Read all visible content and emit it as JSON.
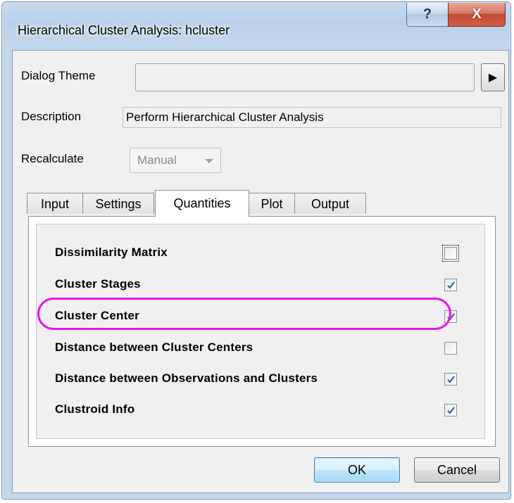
{
  "window": {
    "title": "Hierarchical Cluster Analysis: hcluster",
    "help_glyph": "?",
    "close_glyph": "X"
  },
  "theme": {
    "label": "Dialog Theme",
    "value": "",
    "arrow_glyph": "▶"
  },
  "description": {
    "label": "Description",
    "value": "Perform Hierarchical Cluster Analysis"
  },
  "recalculate": {
    "label": "Recalculate",
    "value": "Manual"
  },
  "tabs": [
    {
      "label": "Input",
      "active": false
    },
    {
      "label": "Settings",
      "active": false
    },
    {
      "label": "Quantities",
      "active": true
    },
    {
      "label": "Plot",
      "active": false
    },
    {
      "label": "Output",
      "active": false
    }
  ],
  "quantities": [
    {
      "label": "Dissimilarity Matrix",
      "checked": false,
      "focused": true
    },
    {
      "label": "Cluster Stages",
      "checked": true
    },
    {
      "label": "Cluster Center",
      "checked": true,
      "highlighted": true
    },
    {
      "label": "Distance between Cluster Centers",
      "checked": false
    },
    {
      "label": "Distance between Observations and Clusters",
      "checked": true
    },
    {
      "label": "Clustroid Info",
      "checked": true
    }
  ],
  "buttons": {
    "ok": "OK",
    "cancel": "Cancel"
  },
  "colors": {
    "highlight": "#ea16e2",
    "check": "#3b5fa8"
  }
}
